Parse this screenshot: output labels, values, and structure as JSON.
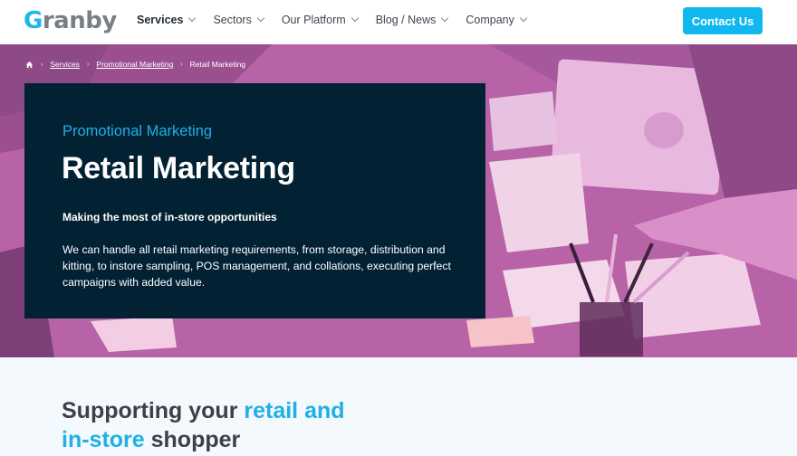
{
  "brand": {
    "name": "Granby",
    "first_letter": "G",
    "rest": "ranby"
  },
  "nav": {
    "items": [
      {
        "label": "Services"
      },
      {
        "label": "Sectors"
      },
      {
        "label": "Our Platform"
      },
      {
        "label": "Blog / News"
      },
      {
        "label": "Company"
      }
    ],
    "cta": "Contact Us"
  },
  "breadcrumb": {
    "items": [
      "Services",
      "Promotional Marketing"
    ],
    "current": "Retail Marketing"
  },
  "hero": {
    "eyebrow": "Promotional Marketing",
    "title": "Retail Marketing",
    "subhead": "Making the most of in-store opportunities",
    "body": "We can handle all retail marketing requirements, from storage, distribution and kitting, to instore sampling, POS management, and collations, executing perfect campaigns with added value."
  },
  "section": {
    "title_part1": "Supporting your ",
    "title_accent1": "retail and",
    "title_accent2": "in-store",
    "title_part2": " shopper"
  },
  "colors": {
    "accent": "#10b8ef",
    "card": "#022234",
    "hero_tint": "#c96eb6"
  }
}
